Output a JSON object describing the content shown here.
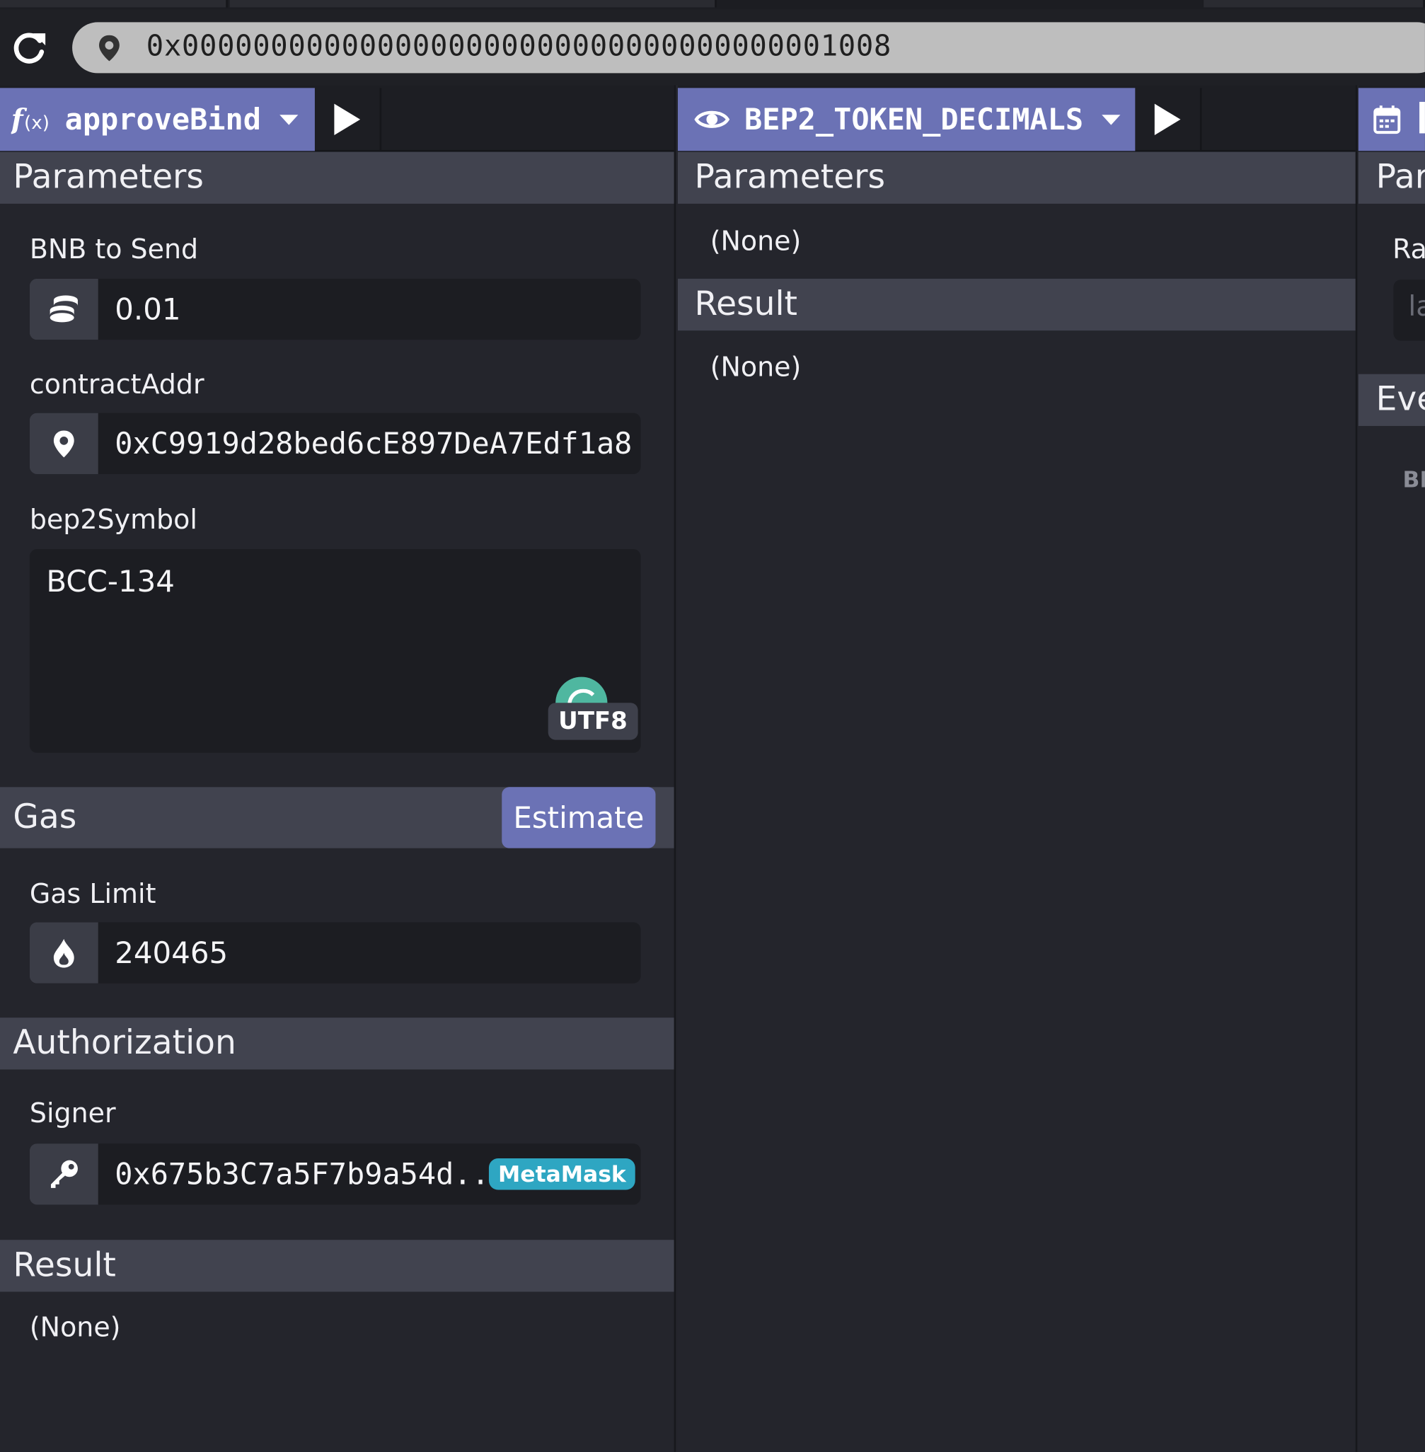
{
  "address_bar": {
    "value": "0x0000000000000000000000000000000000001008"
  },
  "panel_left": {
    "function_name": "approveBind",
    "parameters_heading": "Parameters",
    "bnb_label": "BNB to Send",
    "bnb_value": "0.01",
    "contract_label": "contractAddr",
    "contract_value": "0xC9919d28bed6cE897DeA7Edf1a8",
    "symbol_label": "bep2Symbol",
    "symbol_value": "BCC-134",
    "encoding_badge": "UTF8",
    "gas_heading": "Gas",
    "estimate_label": "Estimate",
    "gas_limit_label": "Gas Limit",
    "gas_limit_value": "240465",
    "authorization_heading": "Authorization",
    "signer_label": "Signer",
    "signer_value": "0x675b3C7a5F7b9a54d...",
    "signer_badge": "MetaMask",
    "result_heading": "Result",
    "result_value": "(None)"
  },
  "panel_middle": {
    "function_name": "BEP2_TOKEN_DECIMALS",
    "parameters_heading": "Parameters",
    "parameters_value": "(None)",
    "result_heading": "Result",
    "result_value": "(None)"
  },
  "panel_right": {
    "parameters_heading": "Par",
    "field_label": "Ra",
    "field_placeholder": "la",
    "events_heading": "Eve",
    "events_text": "BI"
  },
  "colors": {
    "accent": "#6b72b5",
    "section_header": "#41434f",
    "background": "#24252c",
    "utf8_spinner": "#4fb7a0",
    "metamask_badge": "#2ea6c2"
  }
}
